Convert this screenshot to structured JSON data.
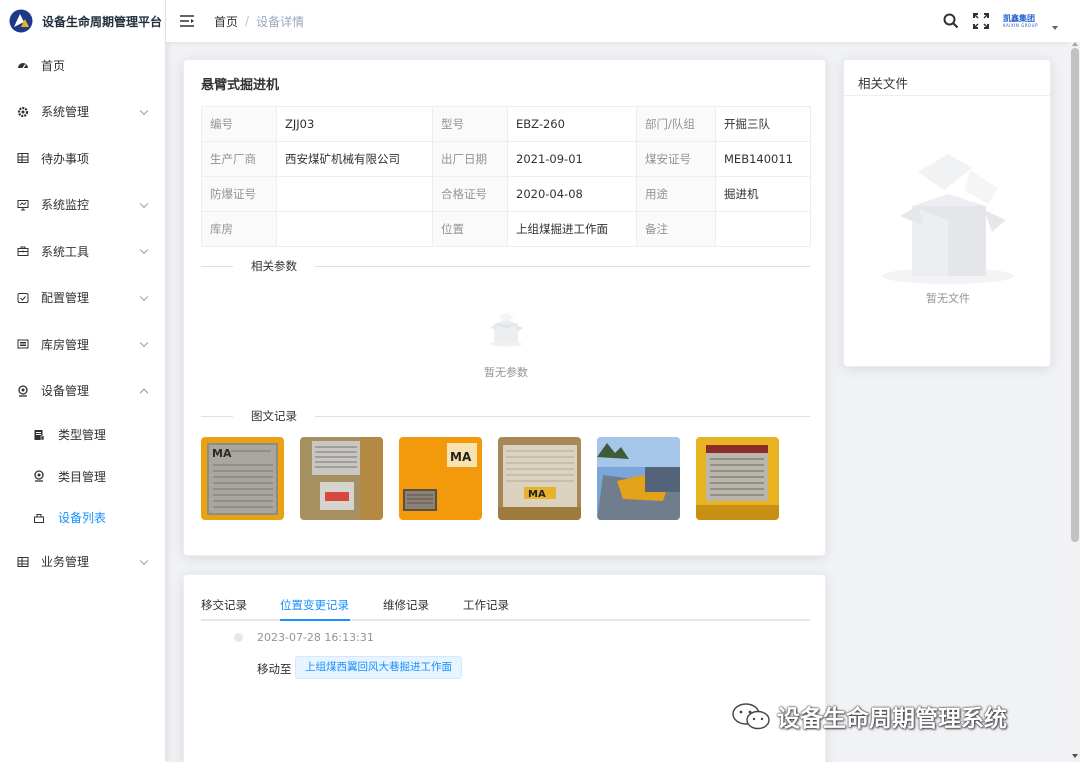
{
  "app": {
    "title": "设备生命周期管理平台"
  },
  "sidebar": {
    "items": [
      {
        "label": "首页",
        "icon": "dashboard-icon"
      },
      {
        "label": "系统管理",
        "icon": "gear-icon"
      },
      {
        "label": "待办事项",
        "icon": "grid-icon"
      },
      {
        "label": "系统监控",
        "icon": "monitor-icon"
      },
      {
        "label": "系统工具",
        "icon": "toolbox-icon"
      },
      {
        "label": "配置管理",
        "icon": "checkbox-icon"
      },
      {
        "label": "库房管理",
        "icon": "storage-icon"
      },
      {
        "label": "设备管理",
        "icon": "camera-icon"
      }
    ],
    "sub_items": [
      {
        "label": "类型管理",
        "icon": "server-icon"
      },
      {
        "label": "类目管理",
        "icon": "webcam-icon"
      },
      {
        "label": "设备列表",
        "icon": "box-icon"
      }
    ],
    "last_item": {
      "label": "业务管理",
      "icon": "grid-icon"
    }
  },
  "header": {
    "breadcrumb": {
      "home": "首页",
      "separator": "/",
      "current": "设备详情"
    },
    "brand_cn": "凯鑫集团",
    "brand_en": "KAIXIN GROUP"
  },
  "device": {
    "title": "悬臂式掘进机",
    "rows": [
      [
        {
          "label": "编号",
          "value": "ZJJ03"
        },
        {
          "label": "型号",
          "value": "EBZ-260"
        },
        {
          "label": "部门/队组",
          "value": "开掘三队"
        }
      ],
      [
        {
          "label": "生产厂商",
          "value": "西安煤矿机械有限公司"
        },
        {
          "label": "出厂日期",
          "value": "2021-09-01"
        },
        {
          "label": "煤安证号",
          "value": "MEB140011"
        }
      ],
      [
        {
          "label": "防爆证号",
          "value": ""
        },
        {
          "label": "合格证号",
          "value": "2020-04-08"
        },
        {
          "label": "用途",
          "value": "掘进机"
        }
      ],
      [
        {
          "label": "库房",
          "value": ""
        },
        {
          "label": "位置",
          "value": "上组煤掘进工作面"
        },
        {
          "label": "备注",
          "value": ""
        }
      ]
    ]
  },
  "params": {
    "heading": "相关参数",
    "empty": "暂无参数"
  },
  "photos": {
    "heading": "图文记录",
    "count": 6
  },
  "files": {
    "title": "相关文件",
    "empty": "暂无文件"
  },
  "tabs": {
    "items": [
      "移交记录",
      "位置变更记录",
      "维修记录",
      "工作记录"
    ],
    "active": "位置变更记录"
  },
  "timeline": {
    "time": "2023-07-28 16:13:31",
    "text": "移动至",
    "tag": "上组煤西翼回风大巷掘进工作面"
  },
  "watermark": "设备生命周期管理系统",
  "colors": {
    "accent": "#1890ff",
    "sidebar_bg": "#ffffff",
    "page_bg": "#f0f2f5"
  }
}
